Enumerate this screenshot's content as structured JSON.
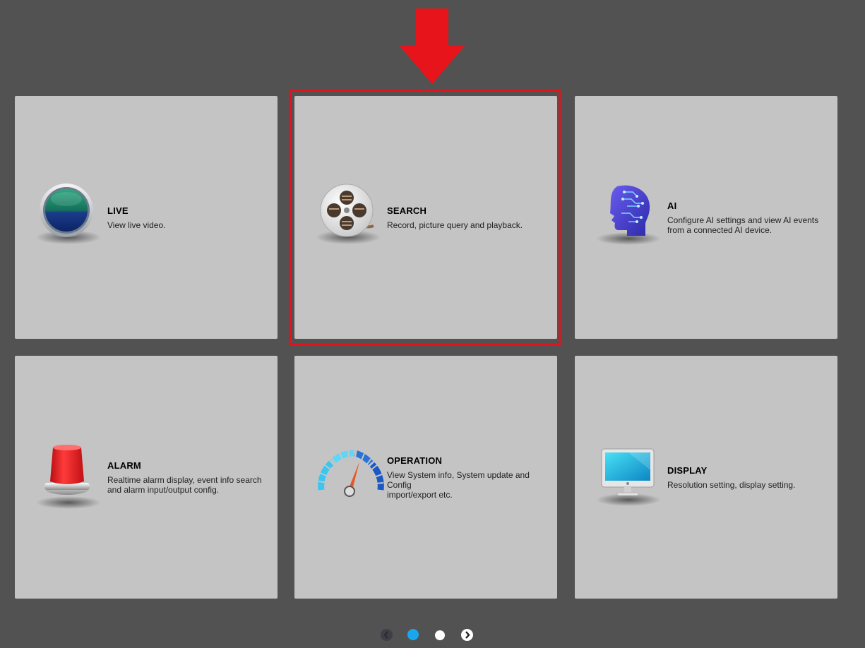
{
  "tiles": {
    "live": {
      "title": "LIVE",
      "desc": "View live video."
    },
    "search": {
      "title": "SEARCH",
      "desc": "Record, picture query and playback."
    },
    "ai": {
      "title": "AI",
      "desc": "Configure AI settings and view AI events\nfrom a connected AI device."
    },
    "alarm": {
      "title": "ALARM",
      "desc": "Realtime alarm display, event info search\nand alarm input/output config."
    },
    "operation": {
      "title": "OPERATION",
      "desc": "View System info, System update and Config\nimport/export etc."
    },
    "display": {
      "title": "DISPLAY",
      "desc": "Resolution setting, display setting."
    }
  },
  "pager": {
    "current_page": 1,
    "total_pages": 2
  },
  "colors": {
    "background": "#525252",
    "tile": "#c4c4c4",
    "highlight": "#e0141c",
    "active_dot": "#1aa6ef"
  },
  "icons": {
    "live": "live-lens-icon",
    "search": "film-reel-icon",
    "ai": "ai-head-icon",
    "alarm": "alarm-beacon-icon",
    "operation": "gauge-icon",
    "display": "monitor-icon"
  }
}
